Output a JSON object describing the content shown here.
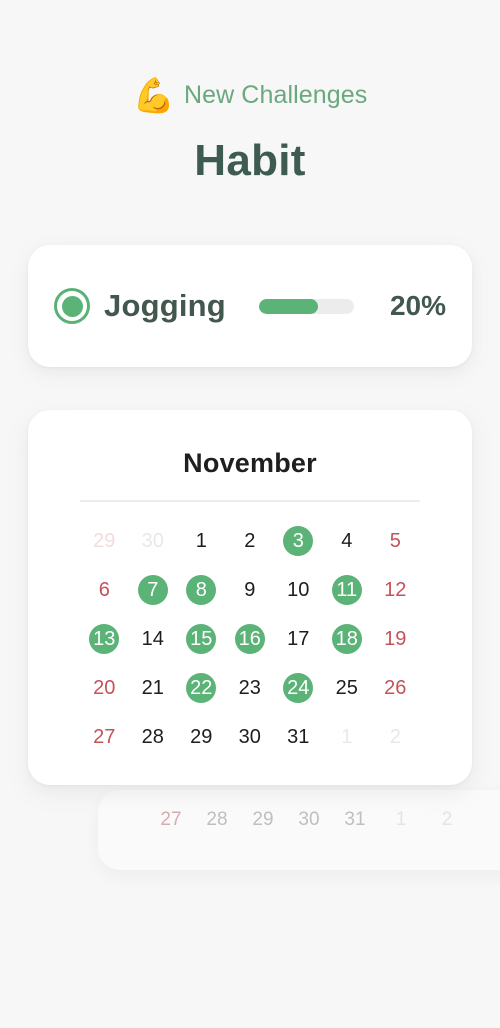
{
  "header": {
    "eyebrow_emoji": "💪",
    "eyebrow_emoji_name": "flexed-biceps-emoji",
    "eyebrow_label": "New Challenges",
    "title": "Habit",
    "eyebrow_color": "#6ba87e",
    "title_color": "#3d5b50"
  },
  "habit": {
    "status_icon": "radio-checked-icon",
    "name": "Jogging",
    "percent_label": "20%",
    "progress_value": 20,
    "progress_fill_ratio": 62,
    "accent_color": "#5cb377",
    "track_color": "#ececec"
  },
  "calendar": {
    "month": "November",
    "accent_color": "#5cb377",
    "sunday_color": "#c4525a",
    "rows": [
      [
        {
          "day": "29",
          "state": "out-sun"
        },
        {
          "day": "30",
          "state": "out"
        },
        {
          "day": "1",
          "state": "normal"
        },
        {
          "day": "2",
          "state": "normal"
        },
        {
          "day": "3",
          "state": "done"
        },
        {
          "day": "4",
          "state": "normal"
        },
        {
          "day": "5",
          "state": "sun"
        }
      ],
      [
        {
          "day": "6",
          "state": "sun"
        },
        {
          "day": "7",
          "state": "done"
        },
        {
          "day": "8",
          "state": "done"
        },
        {
          "day": "9",
          "state": "normal"
        },
        {
          "day": "10",
          "state": "normal"
        },
        {
          "day": "11",
          "state": "done"
        },
        {
          "day": "12",
          "state": "sun"
        }
      ],
      [
        {
          "day": "13",
          "state": "done"
        },
        {
          "day": "14",
          "state": "normal"
        },
        {
          "day": "15",
          "state": "done"
        },
        {
          "day": "16",
          "state": "done"
        },
        {
          "day": "17",
          "state": "normal"
        },
        {
          "day": "18",
          "state": "done"
        },
        {
          "day": "19",
          "state": "sun"
        }
      ],
      [
        {
          "day": "20",
          "state": "sun"
        },
        {
          "day": "21",
          "state": "normal"
        },
        {
          "day": "22",
          "state": "done"
        },
        {
          "day": "23",
          "state": "normal"
        },
        {
          "day": "24",
          "state": "done"
        },
        {
          "day": "25",
          "state": "normal"
        },
        {
          "day": "26",
          "state": "sun"
        }
      ],
      [
        {
          "day": "27",
          "state": "sun"
        },
        {
          "day": "28",
          "state": "normal"
        },
        {
          "day": "29",
          "state": "normal"
        },
        {
          "day": "30",
          "state": "normal"
        },
        {
          "day": "31",
          "state": "normal"
        },
        {
          "day": "1",
          "state": "out"
        },
        {
          "day": "2",
          "state": "out"
        }
      ]
    ]
  },
  "ghost_calendar": {
    "row": [
      {
        "day": "27",
        "state": "sun"
      },
      {
        "day": "28",
        "state": "normal"
      },
      {
        "day": "29",
        "state": "normal"
      },
      {
        "day": "30",
        "state": "normal"
      },
      {
        "day": "31",
        "state": "normal"
      },
      {
        "day": "1",
        "state": "muted"
      },
      {
        "day": "2",
        "state": "muted"
      }
    ]
  }
}
